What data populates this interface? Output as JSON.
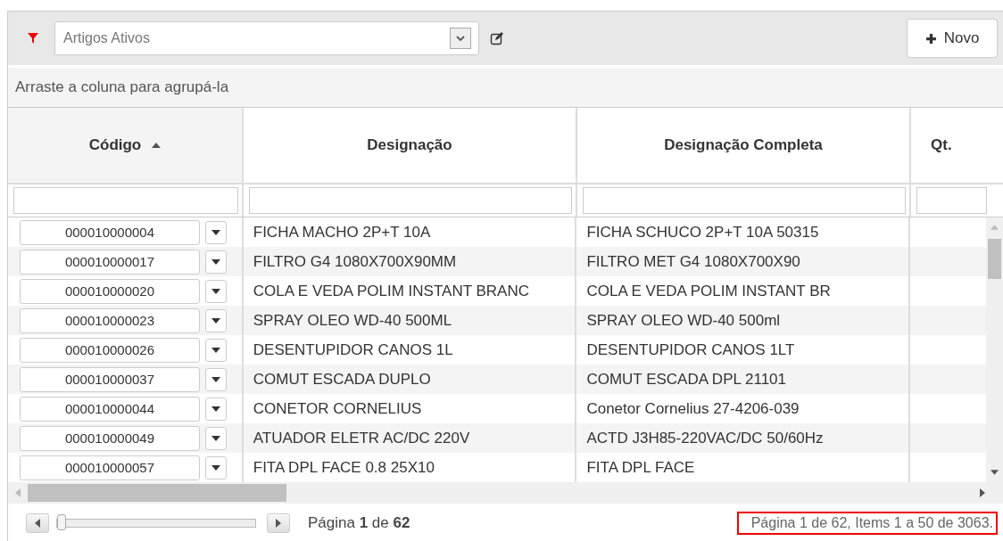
{
  "toolbar": {
    "filter_select": {
      "value": "Artigos Ativos"
    },
    "new_button": "Novo"
  },
  "group_hint": "Arraste a coluna para agrupá-la",
  "columns": [
    {
      "label": "Código",
      "sorted": true
    },
    {
      "label": "Designação",
      "sorted": false
    },
    {
      "label": "Designação Completa",
      "sorted": false
    },
    {
      "label": "Qt.",
      "sorted": false
    }
  ],
  "rows": [
    {
      "code": "000010000004",
      "designation": "FICHA MACHO 2P+T 10A",
      "full_designation": "FICHA SCHUCO 2P+T 10A 50315"
    },
    {
      "code": "000010000017",
      "designation": "FILTRO G4 1080X700X90MM",
      "full_designation": "FILTRO MET G4 1080X700X90"
    },
    {
      "code": "000010000020",
      "designation": "COLA E VEDA POLIM INSTANT BRANC",
      "full_designation": "COLA E VEDA POLIM INSTANT BR"
    },
    {
      "code": "000010000023",
      "designation": "SPRAY OLEO WD-40 500ML",
      "full_designation": "SPRAY OLEO WD-40 500ml"
    },
    {
      "code": "000010000026",
      "designation": "DESENTUPIDOR CANOS 1L",
      "full_designation": "DESENTUPIDOR CANOS 1LT"
    },
    {
      "code": "000010000037",
      "designation": "COMUT ESCADA DUPLO",
      "full_designation": "COMUT ESCADA DPL 21101"
    },
    {
      "code": "000010000044",
      "designation": "CONETOR CORNELIUS",
      "full_designation": "Conetor Cornelius 27-4206-039"
    },
    {
      "code": "000010000049",
      "designation": "ATUADOR ELETR AC/DC 220V",
      "full_designation": "ACTD J3H85-220VAC/DC 50/60Hz"
    },
    {
      "code": "000010000057",
      "designation": "FITA DPL FACE 0.8 25X10",
      "full_designation": "FITA DPL FACE"
    }
  ],
  "pager": {
    "slider": {
      "level": 0
    },
    "page_label": "Página",
    "page": "1",
    "of": "de",
    "total": "62",
    "summary": "Página 1 de 62, Items 1 a 50 de 3063."
  }
}
